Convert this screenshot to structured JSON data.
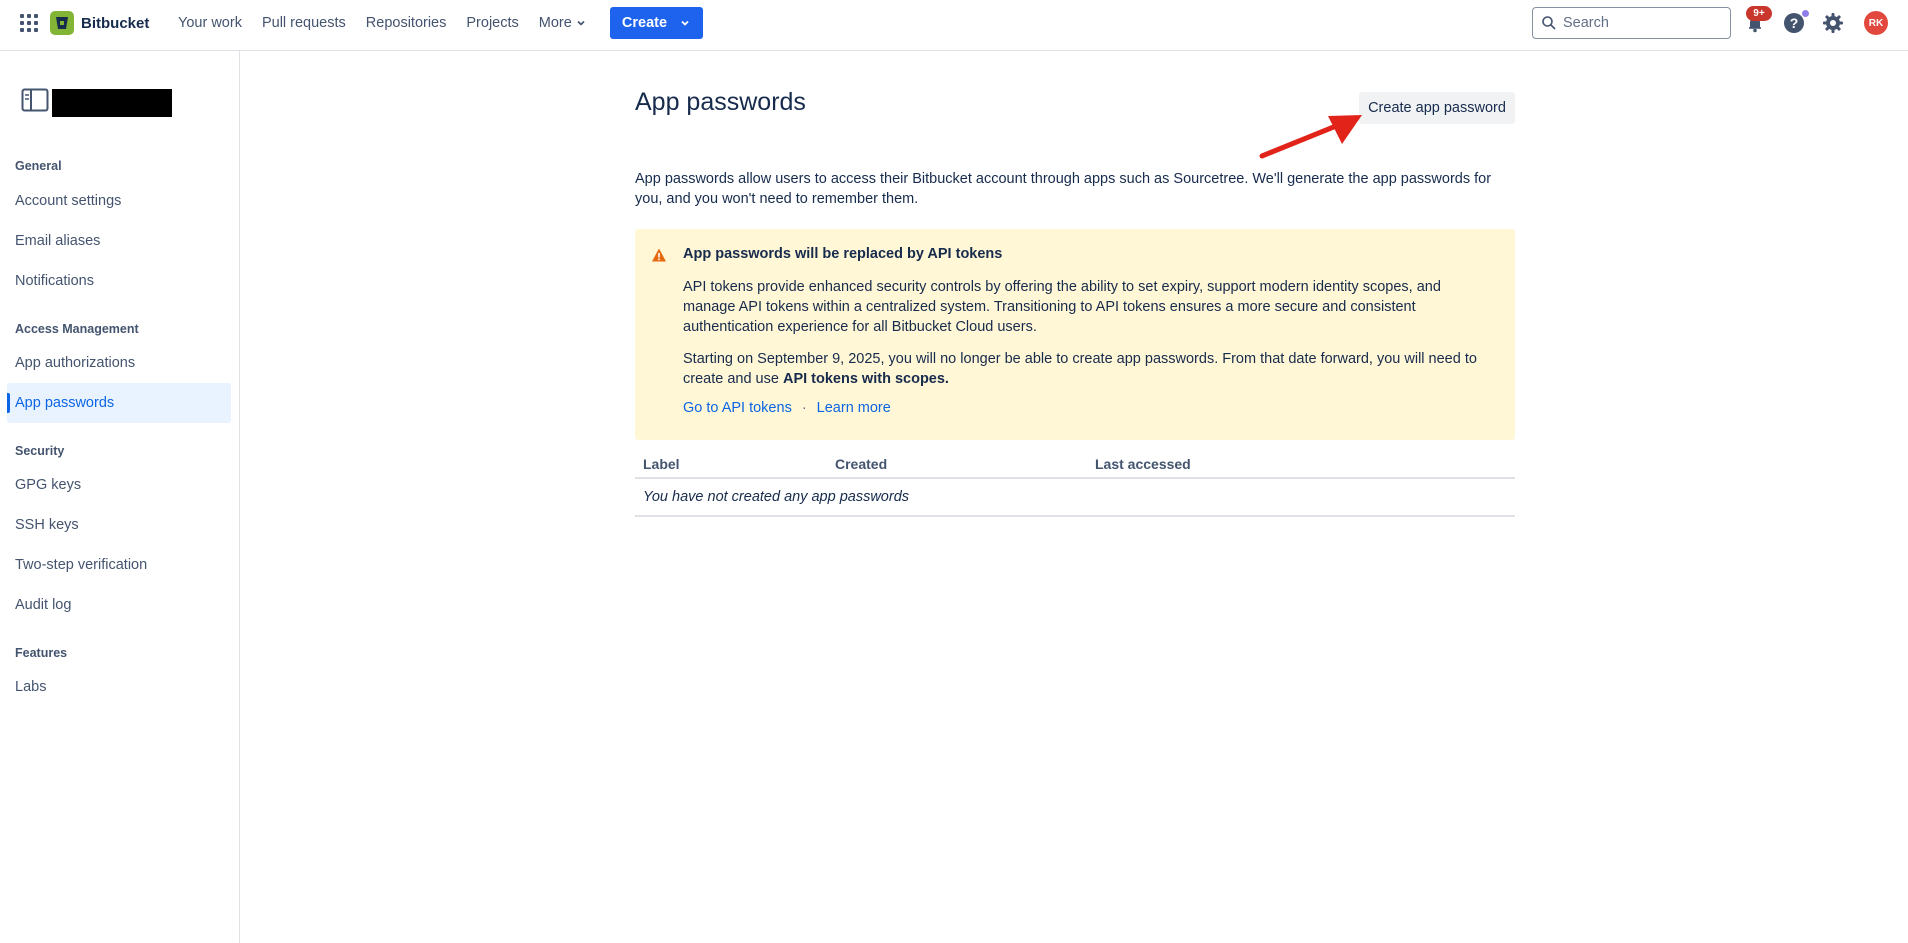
{
  "topnav": {
    "brand": "Bitbucket",
    "links": [
      "Your work",
      "Pull requests",
      "Repositories",
      "Projects",
      "More"
    ],
    "create_label": "Create",
    "search_placeholder": "Search",
    "notification_badge": "9+",
    "avatar_initials": "RK"
  },
  "sidebar": {
    "sections": [
      {
        "title": "General",
        "items": [
          "Account settings",
          "Email aliases",
          "Notifications"
        ]
      },
      {
        "title": "Access Management",
        "items": [
          "App authorizations",
          "App passwords"
        ]
      },
      {
        "title": "Security",
        "items": [
          "GPG keys",
          "SSH keys",
          "Two-step verification",
          "Audit log"
        ]
      },
      {
        "title": "Features",
        "items": [
          "Labs"
        ]
      }
    ],
    "active_item": "App passwords"
  },
  "main": {
    "title": "App passwords",
    "create_button": "Create app password",
    "intro": "App passwords allow users to access their Bitbucket account through apps such as Sourcetree. We'll generate the app passwords for you, and you won't need to remember them.",
    "banner": {
      "title": "App passwords will be replaced by API tokens",
      "p1": "API tokens provide enhanced security controls by offering the ability to set expiry, support modern identity scopes, and manage API tokens within a centralized system. Transitioning to API tokens ensures a more secure and consistent authentication experience for all Bitbucket Cloud users.",
      "p2_prefix": "Starting on September 9, 2025, you will no longer be able to create app passwords. From that date forward, you will need to create and use ",
      "p2_bold": "API tokens with scopes.",
      "link1": "Go to API tokens",
      "separator": "·",
      "link2": "Learn more"
    },
    "table": {
      "columns": [
        "Label",
        "Created",
        "Last accessed"
      ],
      "empty_message": "You have not created any app passwords"
    }
  },
  "colors": {
    "primary": "#1d63ed",
    "banner_bg": "#fff7d6",
    "warning": "#e56910",
    "annotation_arrow": "#e2231a"
  }
}
